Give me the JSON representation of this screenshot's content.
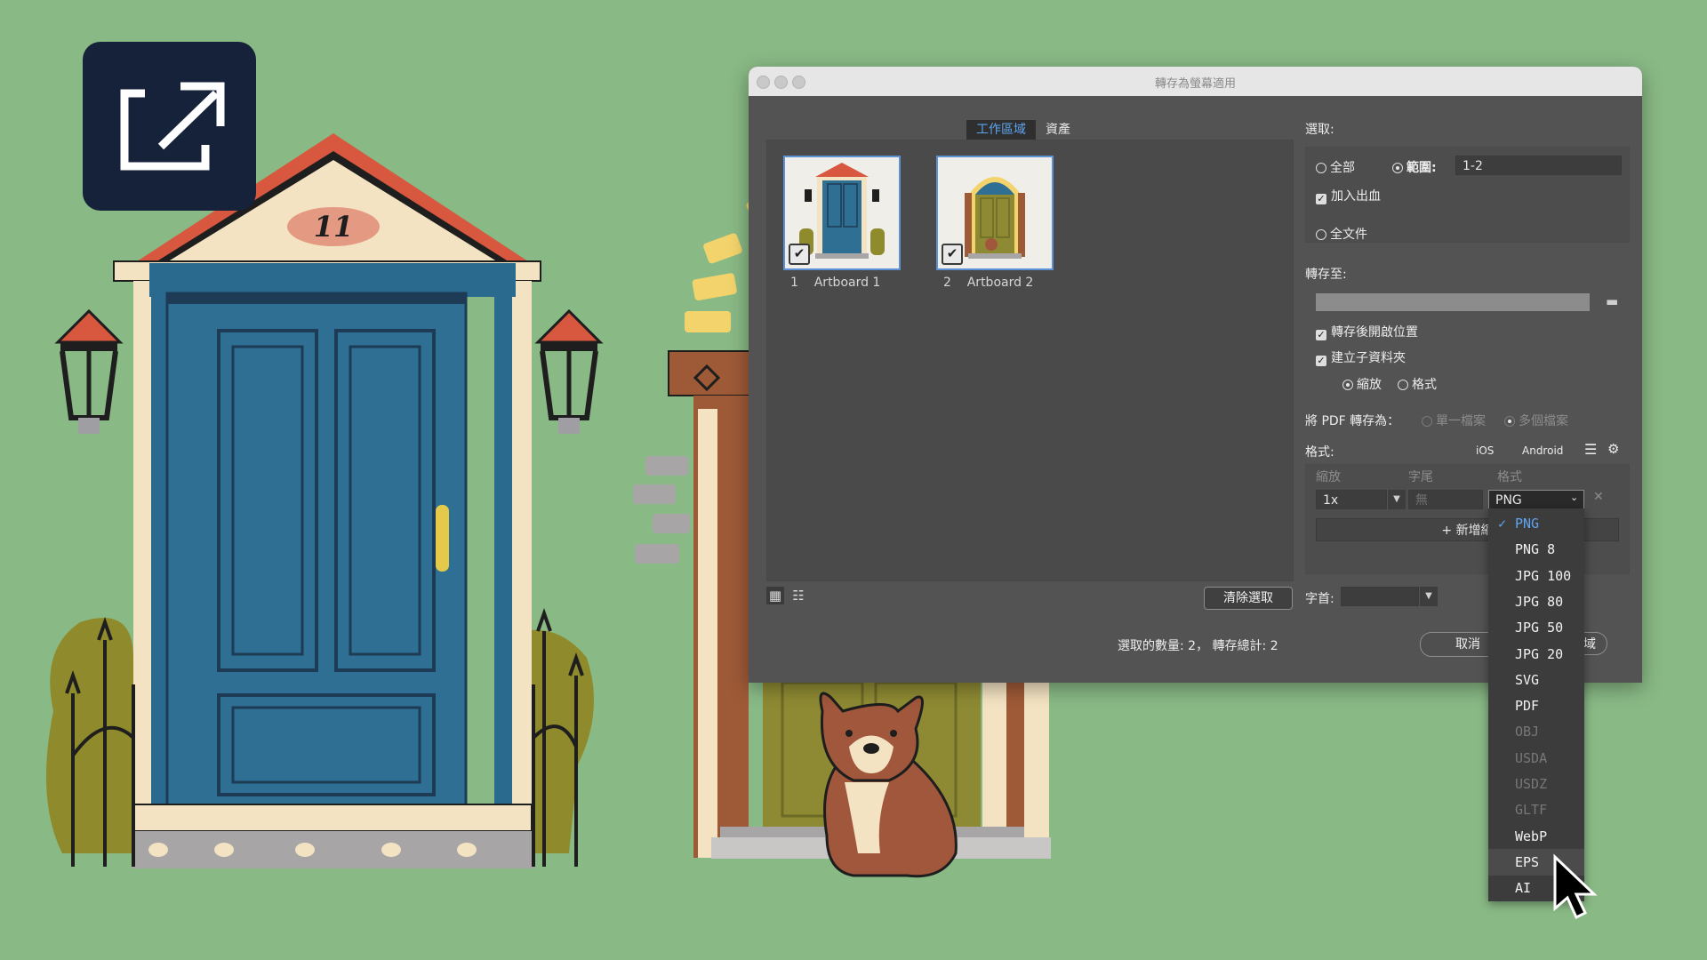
{
  "house": {
    "number": "11"
  },
  "dialog": {
    "title": "轉存為螢幕適用",
    "tabs": [
      {
        "label": "工作區域"
      },
      {
        "label": "資產"
      }
    ],
    "artboards": [
      {
        "num": "1",
        "name": "Artboard 1"
      },
      {
        "num": "2",
        "name": "Artboard 2"
      }
    ],
    "clear_selection": "清除選取",
    "status": "選取的數量: 2， 轉存總計: 2",
    "cancel": "取消",
    "export_button": "作區域",
    "select": {
      "label": "選取:",
      "all": "全部",
      "range": "範圍:",
      "range_value": "1-2",
      "bleed": "加入出血",
      "full_doc": "全文件"
    },
    "export_to": {
      "label": "轉存至:",
      "open_after": "轉存後開啟位置",
      "create_sub": "建立子資料夾",
      "scale": "縮放",
      "format": "格式"
    },
    "pdf": {
      "label": "將 PDF 轉存為：",
      "single": "單一檔案",
      "multiple": "多個檔案"
    },
    "formats": {
      "label": "格式:",
      "ios": "iOS",
      "android": "Android",
      "col_scale": "縮放",
      "col_suffix": "字尾",
      "col_format": "格式",
      "scale_value": "1x",
      "suffix_placeholder": "無",
      "format_value": "PNG",
      "add_scale": "+ 新增縮"
    },
    "prefix_label": "字首:"
  },
  "format_menu": [
    {
      "label": "PNG",
      "selected": true,
      "enabled": true
    },
    {
      "label": "PNG 8",
      "enabled": true
    },
    {
      "label": "JPG 100",
      "enabled": true
    },
    {
      "label": "JPG 80",
      "enabled": true
    },
    {
      "label": "JPG 50",
      "enabled": true
    },
    {
      "label": "JPG 20",
      "enabled": true
    },
    {
      "label": "SVG",
      "enabled": true
    },
    {
      "label": "PDF",
      "enabled": true
    },
    {
      "label": "OBJ",
      "enabled": false
    },
    {
      "label": "USDA",
      "enabled": false
    },
    {
      "label": "USDZ",
      "enabled": false
    },
    {
      "label": "GLTF",
      "enabled": false
    },
    {
      "label": "WebP",
      "enabled": true
    },
    {
      "label": "EPS",
      "enabled": true,
      "hovered": true
    },
    {
      "label": "AI",
      "enabled": true
    }
  ],
  "colors": {
    "background": "#89b985",
    "accent": "#5fa4ef",
    "door_blue": "#2b6a8f"
  }
}
